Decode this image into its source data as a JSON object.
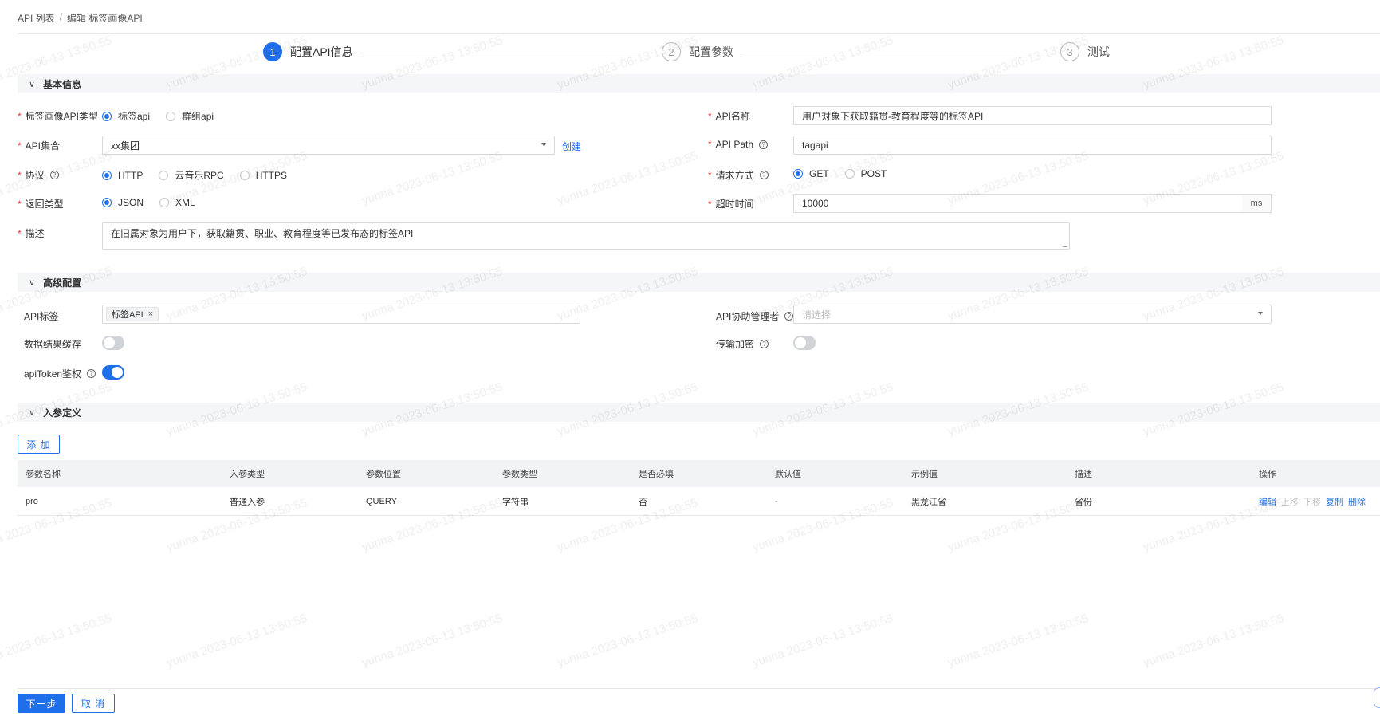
{
  "breadcrumb": {
    "root": "API 列表",
    "separator": "/",
    "current": "编辑 标签画像API"
  },
  "steps": [
    {
      "num": "1",
      "label": "配置API信息"
    },
    {
      "num": "2",
      "label": "配置参数"
    },
    {
      "num": "3",
      "label": "测试"
    }
  ],
  "sections": {
    "basic": "基本信息",
    "advanced": "高级配置",
    "params": "入参定义"
  },
  "basic": {
    "api_type": {
      "label": "标签画像API类型",
      "options": [
        "标签api",
        "群组api"
      ]
    },
    "api_name": {
      "label": "API名称",
      "value": "用户对象下获取籍贯-教育程度等的标签API"
    },
    "collection": {
      "label": "API集合",
      "value": "xx集团",
      "create_link": "创建"
    },
    "api_path": {
      "label": "API Path",
      "value": "tagapi"
    },
    "protocol": {
      "label": "协议",
      "options": [
        "HTTP",
        "云音乐RPC",
        "HTTPS"
      ]
    },
    "method": {
      "label": "请求方式",
      "options": [
        "GET",
        "POST"
      ]
    },
    "return_type": {
      "label": "返回类型",
      "options": [
        "JSON",
        "XML"
      ]
    },
    "timeout": {
      "label": "超时时间",
      "value": "10000",
      "unit": "ms"
    },
    "description": {
      "label": "描述",
      "value": "在旧属对象为用户下，获取籍贯、职业、教育程度等已发布态的标签API"
    }
  },
  "advanced": {
    "api_tag": {
      "label": "API标签",
      "tag": "标签API",
      "close": "×"
    },
    "co_manager": {
      "label": "API协助管理者",
      "placeholder": "请选择"
    },
    "cache": {
      "label": "数据结果缓存",
      "on": false
    },
    "encrypt": {
      "label": "传输加密",
      "on": false
    },
    "token_auth": {
      "label": "apiToken鉴权",
      "on": true
    }
  },
  "params": {
    "add_button": "添 加",
    "columns": [
      "参数名称",
      "入参类型",
      "参数位置",
      "参数类型",
      "是否必填",
      "默认值",
      "示例值",
      "描述",
      "操作"
    ],
    "rows": [
      {
        "name": "pro",
        "in_type": "普通入参",
        "position": "QUERY",
        "type": "字符串",
        "required": "否",
        "default": "-",
        "example": "黑龙江省",
        "desc": "省份"
      }
    ],
    "actions": {
      "edit": "编辑",
      "up": "上移",
      "down": "下移",
      "copy": "复制",
      "delete": "删除"
    }
  },
  "footer": {
    "next": "下一步",
    "cancel": "取 消"
  },
  "watermark": "yunna 2023-06-13 13:50:55",
  "colors": {
    "primary": "#1f6feb",
    "required": "#e4393c",
    "section_bg": "#f5f6f8"
  }
}
